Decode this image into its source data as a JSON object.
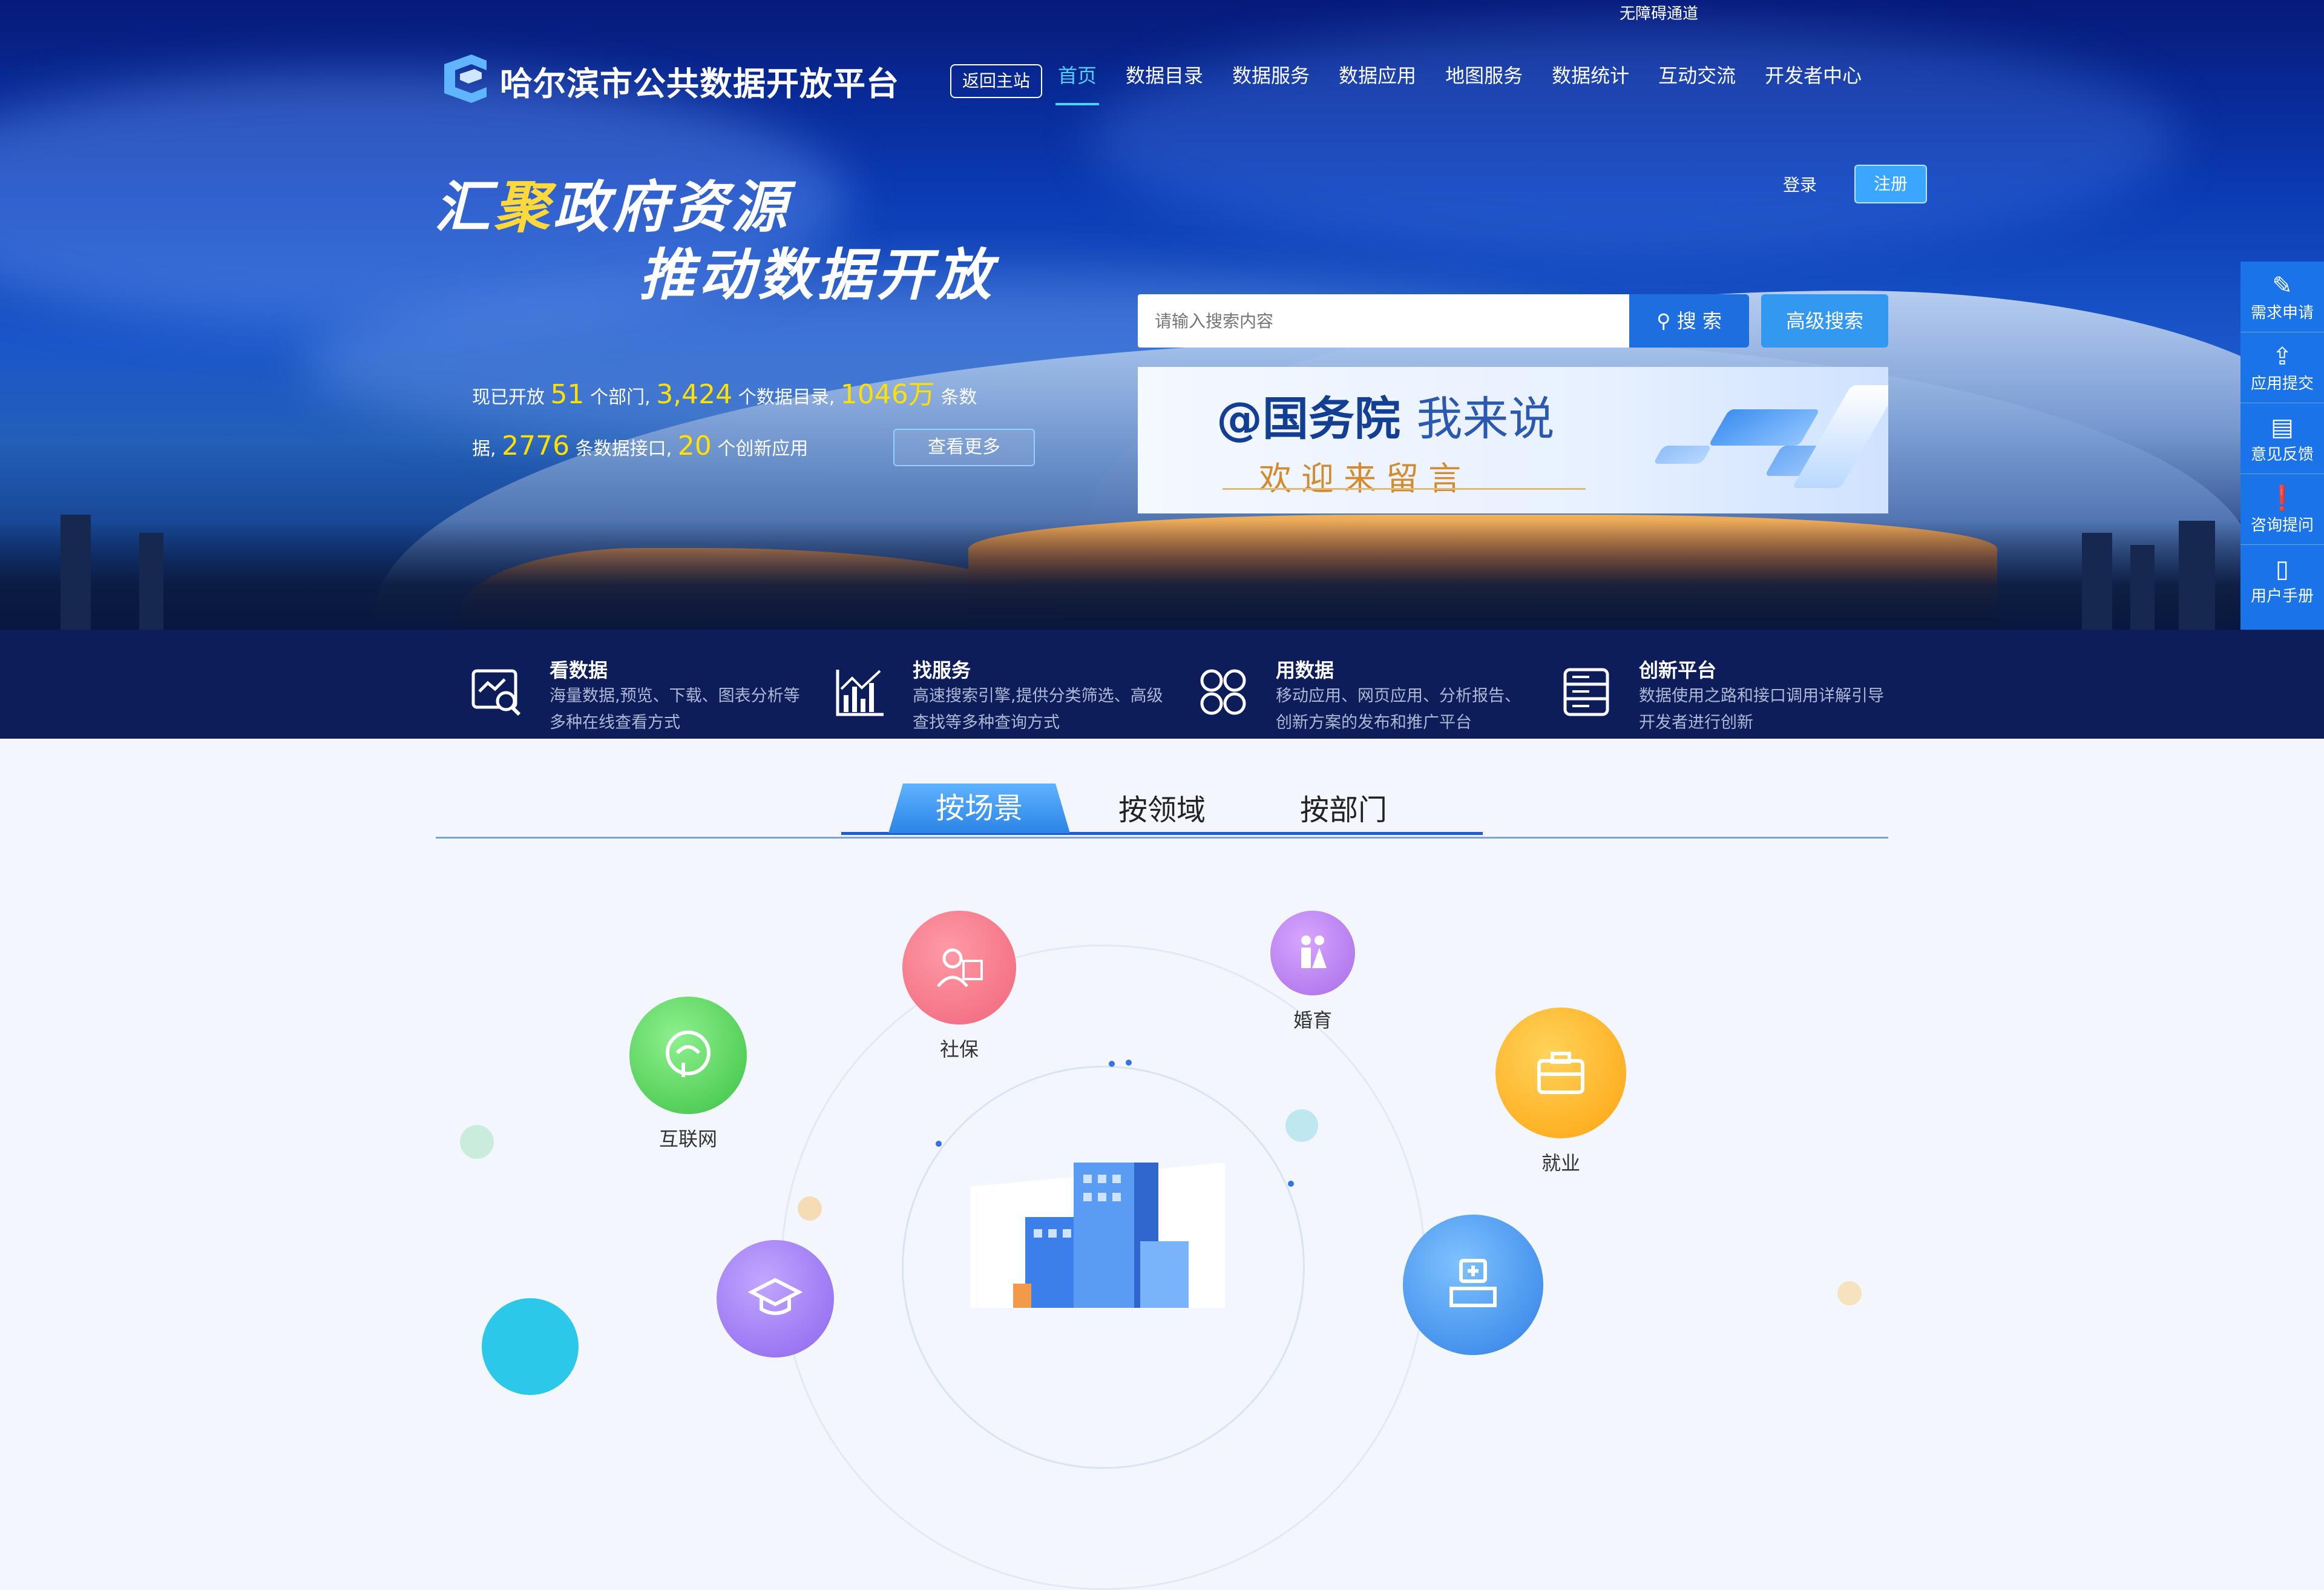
{
  "header": {
    "accessibility": "无障碍通道",
    "site_name": "哈尔滨市公共数据开放平台",
    "back_label": "返回主站",
    "nav": [
      "首页",
      "数据目录",
      "数据服务",
      "数据应用",
      "地图服务",
      "数据统计",
      "互动交流",
      "开发者中心"
    ],
    "login": "登录",
    "register": "注册"
  },
  "hero": {
    "slogan_line1_a": "汇",
    "slogan_line1_b": "聚",
    "slogan_line1_c": "政府资源",
    "slogan_line2": "推动数据开放",
    "search_placeholder": "请输入搜索内容",
    "search_button": "搜 索",
    "advanced_button": "高级搜索",
    "stats": {
      "p1": "现已开放",
      "departments": "51",
      "p2": "个部门,",
      "catalogs": "3,424",
      "p3": "个数据目录,",
      "records": "1046万",
      "p4": "条数",
      "p5": "据,",
      "interfaces": "2776",
      "p6": "条数据接口,",
      "apps": "20",
      "p7": "个创新应用",
      "more": "查看更多"
    },
    "banner": {
      "title_a": "@国务院",
      "title_b": "我来说",
      "subtitle": "欢迎来留言"
    }
  },
  "sidebar": [
    {
      "icon": "edit-icon",
      "label": "需求申请"
    },
    {
      "icon": "upload-icon",
      "label": "应用提交"
    },
    {
      "icon": "document-icon",
      "label": "意见反馈"
    },
    {
      "icon": "alert-icon",
      "label": "咨询提问"
    },
    {
      "icon": "book-icon",
      "label": "用户手册"
    }
  ],
  "features": [
    {
      "title": "看数据",
      "desc": "海量数据,预览、下载、图表分析等多种在线查看方式",
      "icon": "view-data-icon"
    },
    {
      "title": "找服务",
      "desc": "高速搜索引擎,提供分类筛选、高级查找等多种查询方式",
      "icon": "chart-icon"
    },
    {
      "title": "用数据",
      "desc": "移动应用、网页应用、分析报告、创新方案的发布和推广平台",
      "icon": "apps-icon"
    },
    {
      "title": "创新平台",
      "desc": "数据使用之路和接口调用详解引导开发者进行创新",
      "icon": "server-icon"
    }
  ],
  "tabs": [
    "按场景",
    "按领域",
    "按部门"
  ],
  "scenes": [
    {
      "label": "社保",
      "color": "#f26f7c",
      "icon": "social-security-icon"
    },
    {
      "label": "婚育",
      "color": "#b57af0",
      "icon": "family-icon"
    },
    {
      "label": "互联网",
      "color": "#52cf5a",
      "icon": "internet-icon"
    },
    {
      "label": "就业",
      "color": "#ffae1f",
      "icon": "briefcase-icon"
    },
    {
      "label": "",
      "color": "#9d7cf0",
      "icon": "education-icon"
    },
    {
      "label": "",
      "color": "#3f8ff0",
      "icon": "medical-icon"
    }
  ],
  "colors": {
    "accent": "#4fd0ff",
    "primary": "#1a73e8",
    "strip": "#0c1d5a",
    "highlight": "#ffe000"
  }
}
